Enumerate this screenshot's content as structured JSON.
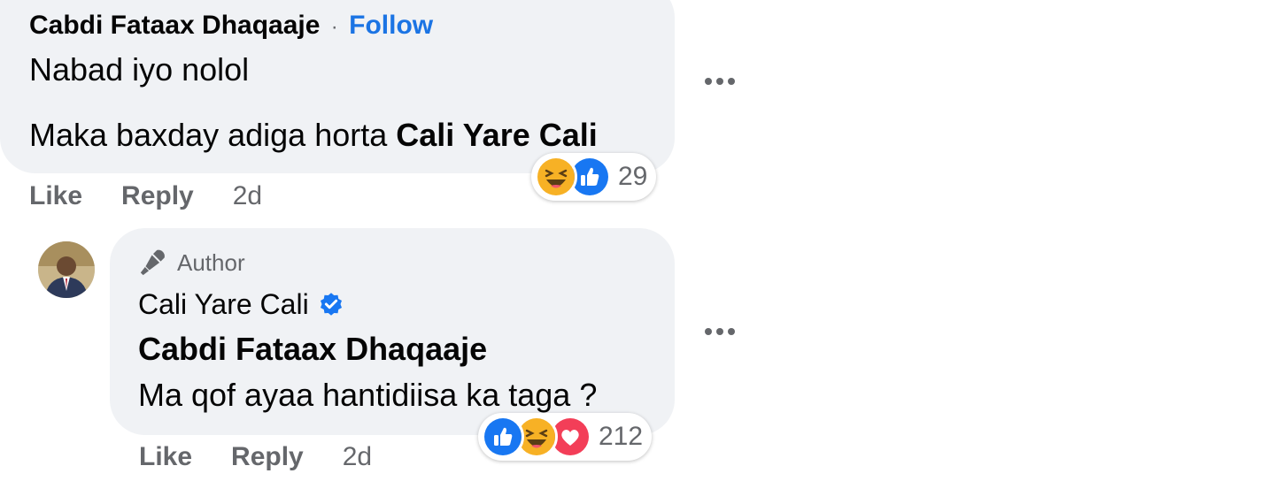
{
  "comment": {
    "author": "Cabdi Fataax Dhaqaaje",
    "separator": "·",
    "follow_label": "Follow",
    "line1": "Nabad iyo nolol",
    "line2_text": "Maka baxday adiga horta ",
    "line2_mention": "Cali Yare Cali",
    "like_label": "Like",
    "reply_label": "Reply",
    "time": "2d",
    "reactions": {
      "icons": [
        "haha-icon",
        "like-icon"
      ],
      "count": "29"
    }
  },
  "reply": {
    "badge_label": "Author",
    "author": "Cali Yare Cali",
    "verified_icon": "verified-badge-icon",
    "mention": "Cabdi Fataax Dhaqaaje",
    "text": "Ma qof ayaa hantidiisa ka taga ?",
    "like_label": "Like",
    "reply_label": "Reply",
    "time": "2d",
    "reactions": {
      "icons": [
        "like-icon",
        "haha-icon",
        "love-icon"
      ],
      "count": "212"
    }
  },
  "colors": {
    "bubble": "#f0f2f5",
    "link_blue": "#1b74e4",
    "muted": "#65676b",
    "like_blue": "#1877f2",
    "love_red": "#f33e58",
    "haha_yellow": "#f7b125"
  }
}
